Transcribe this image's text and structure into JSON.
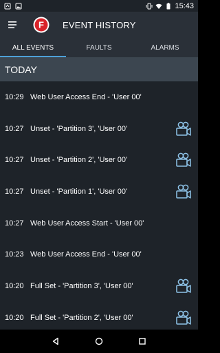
{
  "status_bar": {
    "time": "15:43",
    "left_icons": [
      "notification-icon",
      "image-icon"
    ],
    "right_icons": [
      "vibrate-icon",
      "wifi-icon",
      "battery-icon"
    ]
  },
  "app_bar": {
    "title": "EVENT HISTORY",
    "menu_icon": "hamburger-menu-icon",
    "logo_letter": "F",
    "colors": {
      "logo_red": "#d8232a",
      "bar": "#2a3038"
    }
  },
  "tabs": [
    {
      "label": "ALL EVENTS",
      "active": true
    },
    {
      "label": "FAULTS",
      "active": false
    },
    {
      "label": "ALARMS",
      "active": false
    }
  ],
  "section": {
    "title": "TODAY"
  },
  "events": [
    {
      "time": "10:29",
      "text": "Web User Access End - 'User 00'",
      "camera": false
    },
    {
      "time": "10:27",
      "text": "Unset - 'Partition 3', 'User 00'",
      "camera": true
    },
    {
      "time": "10:27",
      "text": "Unset - 'Partition 2', 'User 00'",
      "camera": true
    },
    {
      "time": "10:27",
      "text": "Unset - 'Partition 1', 'User 00'",
      "camera": true
    },
    {
      "time": "10:27",
      "text": "Web User Access Start - 'User 00'",
      "camera": false
    },
    {
      "time": "10:23",
      "text": "Web User Access End - 'User 00'",
      "camera": false
    },
    {
      "time": "10:20",
      "text": "Full Set - 'Partition 3', 'User 00'",
      "camera": true
    },
    {
      "time": "10:20",
      "text": "Full Set - 'Partition 2', 'User 00'",
      "camera": true
    }
  ],
  "nav_bar": {
    "buttons": [
      "back-icon",
      "home-icon",
      "recents-icon"
    ]
  },
  "accent_color": "#4ea0d8"
}
